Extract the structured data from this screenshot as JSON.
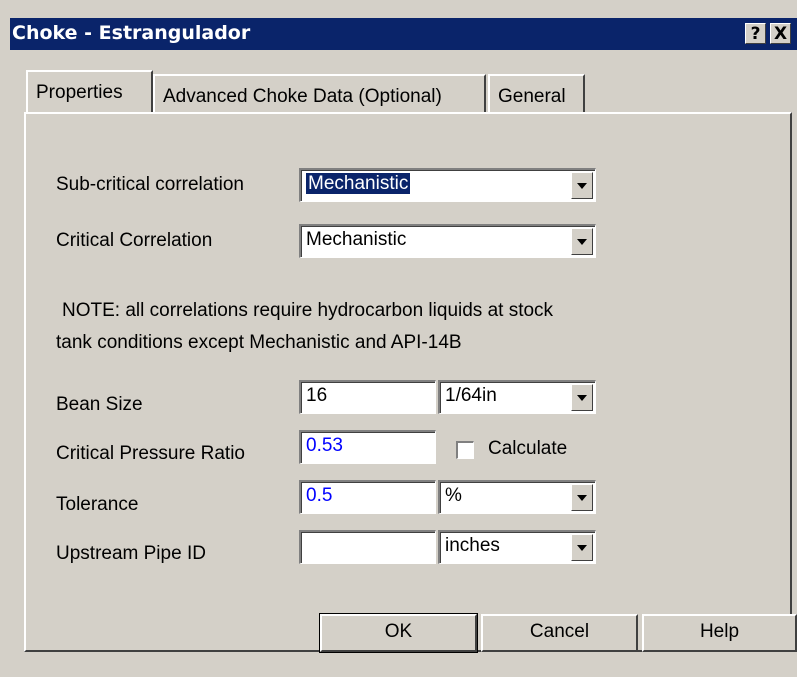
{
  "window": {
    "title": "Choke - Estrangulador",
    "help_btn": "?",
    "close_btn": "X"
  },
  "tabs": [
    {
      "label": "Properties",
      "active": true
    },
    {
      "label": "Advanced Choke Data (Optional)",
      "active": false
    },
    {
      "label": "General",
      "active": false
    }
  ],
  "form": {
    "subcritical_label": "Sub-critical correlation",
    "subcritical_value": "Mechanistic",
    "critical_label": "Critical Correlation",
    "critical_value": "Mechanistic",
    "note_line1": "NOTE: all correlations require hydrocarbon liquids at stock",
    "note_line2": "tank conditions except Mechanistic and API-14B",
    "bean_label": "Bean Size",
    "bean_value": "16",
    "bean_unit": "1/64in",
    "cpr_label": "Critical Pressure Ratio",
    "cpr_value": "0.53",
    "calculate_label": "Calculate",
    "calculate_checked": false,
    "tolerance_label": "Tolerance",
    "tolerance_value": "0.5",
    "tolerance_unit": "%",
    "pipe_label": "Upstream Pipe ID",
    "pipe_value": "",
    "pipe_unit": "inches"
  },
  "buttons": {
    "ok": "OK",
    "cancel": "Cancel",
    "help": "Help"
  }
}
